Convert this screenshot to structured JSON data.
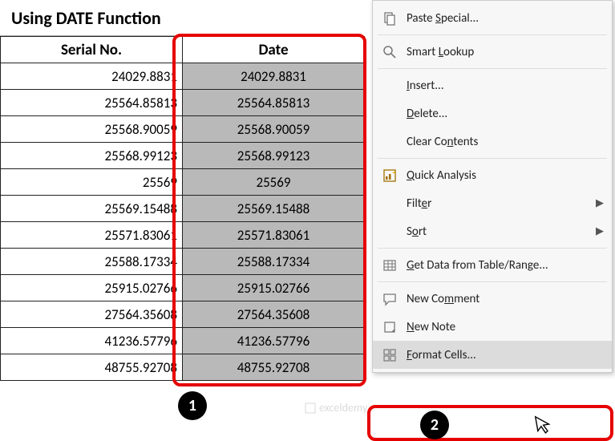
{
  "title": "Using DATE Function",
  "columns": {
    "serial": "Serial No.",
    "date": "Date"
  },
  "rows": [
    {
      "serial": "24029.8831",
      "date": "24029.8831"
    },
    {
      "serial": "25564.85813",
      "date": "25564.85813"
    },
    {
      "serial": "25568.90059",
      "date": "25568.90059"
    },
    {
      "serial": "25568.99123",
      "date": "25568.99123"
    },
    {
      "serial": "25569",
      "date": "25569"
    },
    {
      "serial": "25569.15488",
      "date": "25569.15488"
    },
    {
      "serial": "25571.83061",
      "date": "25571.83061"
    },
    {
      "serial": "25588.17334",
      "date": "25588.17334"
    },
    {
      "serial": "25915.02766",
      "date": "25915.02766"
    },
    {
      "serial": "27564.35608",
      "date": "27564.35608"
    },
    {
      "serial": "41236.57796",
      "date": "41236.57796"
    },
    {
      "serial": "48755.92708",
      "date": "48755.92708"
    }
  ],
  "badges": {
    "one": "1",
    "two": "2"
  },
  "menu": {
    "paste_special": "Paste Special...",
    "smart_lookup": "Smart Lookup",
    "insert": "Insert...",
    "delete": "Delete...",
    "clear": "Clear Contents",
    "quick": "Quick Analysis",
    "filter": "Filter",
    "sort": "Sort",
    "get_data": "Get Data from Table/Range...",
    "new_comment": "New Comment",
    "new_note": "New Note",
    "format_cells": "Format Cells..."
  },
  "watermark": "exceldemy"
}
